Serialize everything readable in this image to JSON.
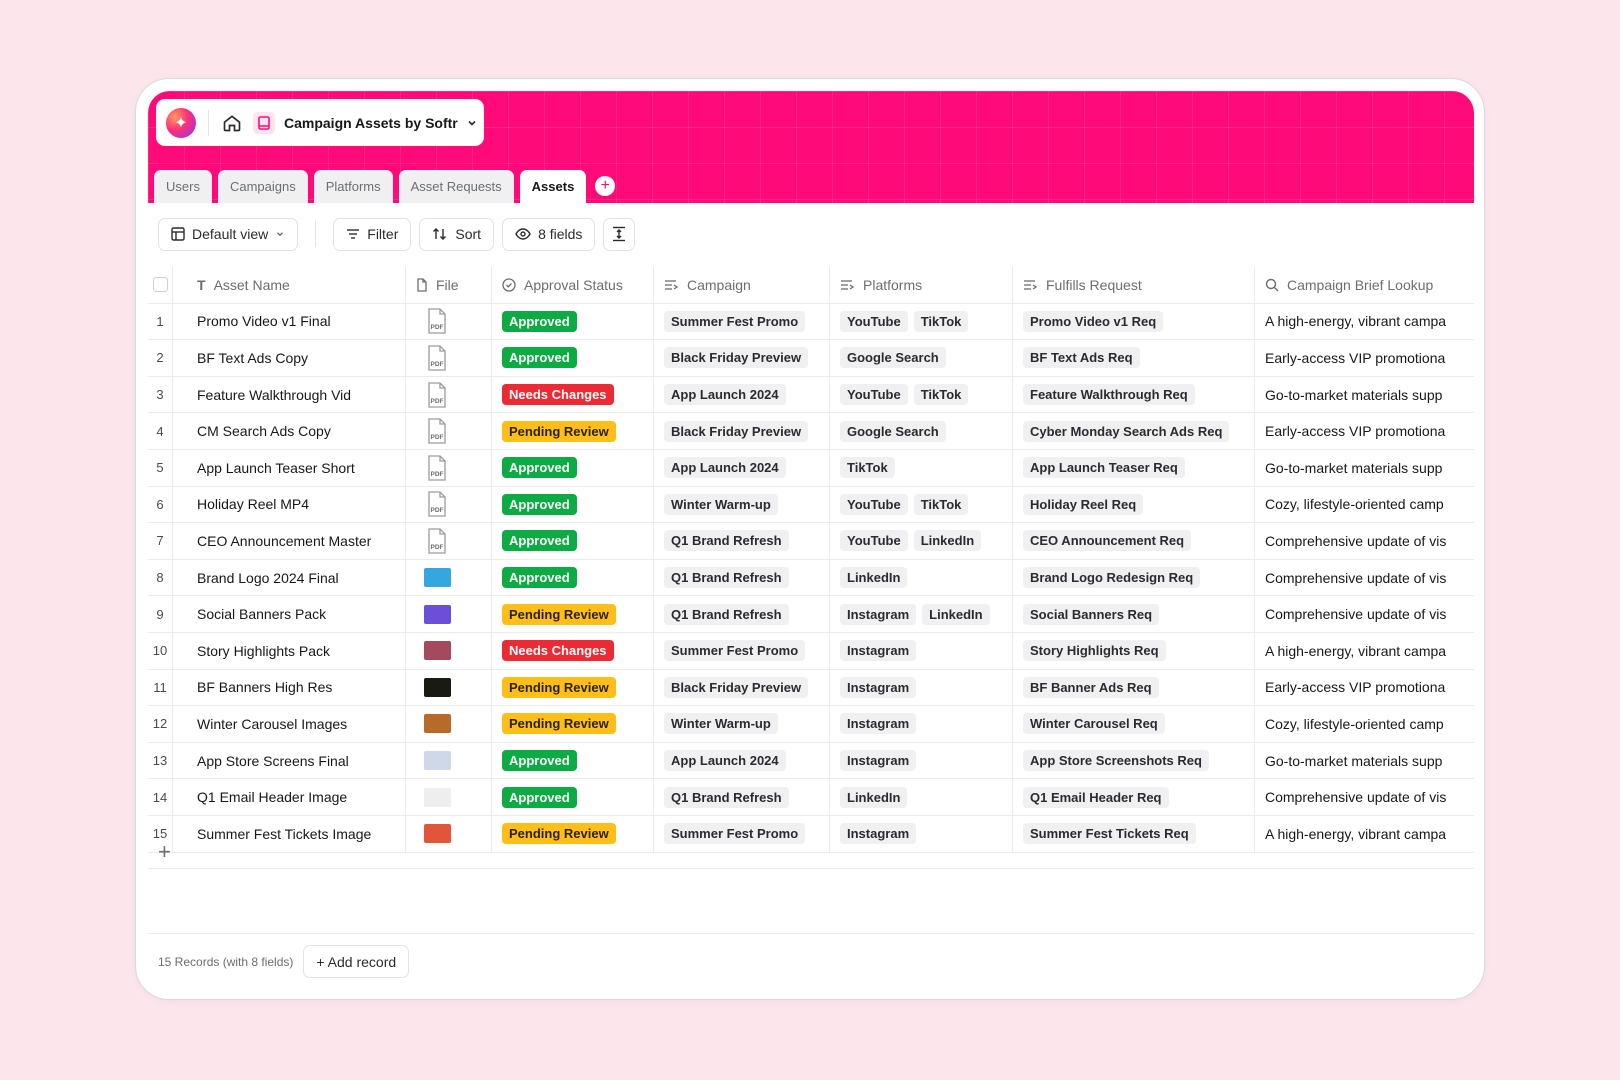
{
  "app": {
    "title": "Campaign Assets by Softr"
  },
  "tabs": [
    "Users",
    "Campaigns",
    "Platforms",
    "Asset Requests",
    "Assets"
  ],
  "active_tab": "Assets",
  "toolbar": {
    "view": "Default view",
    "filter": "Filter",
    "sort": "Sort",
    "fields": "8 fields"
  },
  "columns": [
    "Asset Name",
    "File",
    "Approval Status",
    "Campaign",
    "Platforms",
    "Fulfills Request",
    "Campaign Brief Lookup"
  ],
  "rows": [
    {
      "n": "1",
      "name": "Promo Video v1 Final",
      "file": "pdf",
      "status": "Approved",
      "campaign": "Summer Fest Promo",
      "platforms": [
        "YouTube",
        "TikTok"
      ],
      "request": "Promo Video v1 Req",
      "brief": "A high-energy, vibrant campa"
    },
    {
      "n": "2",
      "name": "BF Text Ads Copy",
      "file": "pdf",
      "status": "Approved",
      "campaign": "Black Friday Preview",
      "platforms": [
        "Google Search"
      ],
      "request": "BF Text Ads Req",
      "brief": "Early-access VIP promotiona"
    },
    {
      "n": "3",
      "name": "Feature Walkthrough Vid",
      "file": "pdf",
      "status": "Needs Changes",
      "campaign": "App Launch 2024",
      "platforms": [
        "YouTube",
        "TikTok"
      ],
      "request": "Feature Walkthrough Req",
      "brief": "Go-to-market materials supp"
    },
    {
      "n": "4",
      "name": "CM Search Ads Copy",
      "file": "pdf",
      "status": "Pending Review",
      "campaign": "Black Friday Preview",
      "platforms": [
        "Google Search"
      ],
      "request": "Cyber Monday Search Ads Req",
      "brief": "Early-access VIP promotiona"
    },
    {
      "n": "5",
      "name": "App Launch Teaser Short",
      "file": "pdf",
      "status": "Approved",
      "campaign": "App Launch 2024",
      "platforms": [
        "TikTok"
      ],
      "request": "App Launch Teaser Req",
      "brief": "Go-to-market materials supp"
    },
    {
      "n": "6",
      "name": "Holiday Reel MP4",
      "file": "pdf",
      "status": "Approved",
      "campaign": "Winter Warm-up",
      "platforms": [
        "YouTube",
        "TikTok"
      ],
      "request": "Holiday Reel Req",
      "brief": "Cozy, lifestyle-oriented camp"
    },
    {
      "n": "7",
      "name": "CEO Announcement Master",
      "file": "pdf",
      "status": "Approved",
      "campaign": "Q1 Brand Refresh",
      "platforms": [
        "YouTube",
        "LinkedIn"
      ],
      "request": "CEO Announcement Req",
      "brief": "Comprehensive update of vis"
    },
    {
      "n": "8",
      "name": "Brand Logo 2024 Final",
      "file": "img",
      "thumb": "#35a7e0",
      "status": "Approved",
      "campaign": "Q1 Brand Refresh",
      "platforms": [
        "LinkedIn"
      ],
      "request": "Brand Logo Redesign Req",
      "brief": "Comprehensive update of vis"
    },
    {
      "n": "9",
      "name": "Social Banners Pack",
      "file": "img",
      "thumb": "#6b4fd8",
      "status": "Pending Review",
      "campaign": "Q1 Brand Refresh",
      "platforms": [
        "Instagram",
        "LinkedIn"
      ],
      "request": "Social Banners Req",
      "brief": "Comprehensive update of vis"
    },
    {
      "n": "10",
      "name": "Story Highlights Pack",
      "file": "img",
      "thumb": "#a44a5e",
      "status": "Needs Changes",
      "campaign": "Summer Fest Promo",
      "platforms": [
        "Instagram"
      ],
      "request": "Story Highlights Req",
      "brief": "A high-energy, vibrant campa"
    },
    {
      "n": "11",
      "name": "BF Banners High Res",
      "file": "img",
      "thumb": "#1a1a12",
      "status": "Pending Review",
      "campaign": "Black Friday Preview",
      "platforms": [
        "Instagram"
      ],
      "request": "BF Banner Ads Req",
      "brief": "Early-access VIP promotiona"
    },
    {
      "n": "12",
      "name": "Winter Carousel Images",
      "file": "img",
      "thumb": "#b86a2a",
      "status": "Pending Review",
      "campaign": "Winter Warm-up",
      "platforms": [
        "Instagram"
      ],
      "request": "Winter Carousel Req",
      "brief": "Cozy, lifestyle-oriented camp"
    },
    {
      "n": "13",
      "name": "App Store Screens Final",
      "file": "img",
      "thumb": "#cfd8e8",
      "status": "Approved",
      "campaign": "App Launch 2024",
      "platforms": [
        "Instagram"
      ],
      "request": "App Store Screenshots Req",
      "brief": "Go-to-market materials supp"
    },
    {
      "n": "14",
      "name": "Q1 Email Header Image",
      "file": "img",
      "thumb": "#eeeeee",
      "status": "Approved",
      "campaign": "Q1 Brand Refresh",
      "platforms": [
        "LinkedIn"
      ],
      "request": "Q1 Email Header Req",
      "brief": "Comprehensive update of vis"
    },
    {
      "n": "15",
      "name": "Summer Fest Tickets Image",
      "file": "img",
      "thumb": "#e2553a",
      "status": "Pending Review",
      "campaign": "Summer Fest Promo",
      "platforms": [
        "Instagram"
      ],
      "request": "Summer Fest Tickets Req",
      "brief": "A high-energy, vibrant campa"
    }
  ],
  "footer": {
    "count": "15 Records (with 8 fields)",
    "add": "+ Add record"
  },
  "colors": {
    "brand": "#ff0a78",
    "approved": "#0dab43",
    "needs_changes": "#ec2a34",
    "pending": "#ffbf18"
  },
  "icons": [
    "sparkle-logo-icon",
    "home-icon",
    "app-book-icon",
    "chevron-down-icon",
    "table-icon",
    "filter-icon",
    "sort-icon",
    "eye-icon",
    "row-height-icon",
    "text-field-icon",
    "file-icon",
    "status-icon",
    "link-icon",
    "lookup-search-icon",
    "plus-icon"
  ]
}
